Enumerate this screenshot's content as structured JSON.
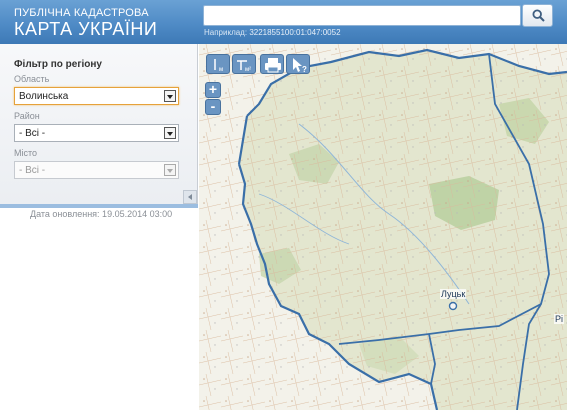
{
  "header": {
    "logo_top": "ПУБЛІЧНА КАДАСТРОВА",
    "logo_main": "КАРТА УКРАЇНИ",
    "search": {
      "value": "",
      "placeholder": ""
    },
    "search_button_icon": "search-icon",
    "example_prefix": "Наприклад:",
    "example_number": "3221855100:01:047:0052"
  },
  "sidebar": {
    "filter_title": "Фільтр по регіону",
    "oblast": {
      "label": "Область",
      "value": "Волинська"
    },
    "rayon": {
      "label": "Район",
      "value": "- Всі -"
    },
    "misto": {
      "label": "Місто",
      "value": "- Всі -"
    },
    "collapse_icon": "chevron-left-icon",
    "update_date": "Дата оновлення: 19.05.2014 03:00"
  },
  "map": {
    "toolbar": [
      {
        "name": "ruler-distance-tool",
        "icon": "ruler-icon",
        "unit": "м"
      },
      {
        "name": "ruler-area-tool",
        "icon": "area-ruler-icon",
        "unit": "м²"
      },
      {
        "name": "print-tool",
        "icon": "printer-icon"
      },
      {
        "name": "identify-tool",
        "icon": "cursor-question-icon"
      }
    ],
    "zoom_in": "+",
    "zoom_out": "-",
    "city_lutsk": "Луцьк",
    "city_edge": "Рі",
    "colors": {
      "border": "#3a6fa8",
      "land": "#e3e6cf",
      "forest": "#b9cf9f"
    }
  }
}
